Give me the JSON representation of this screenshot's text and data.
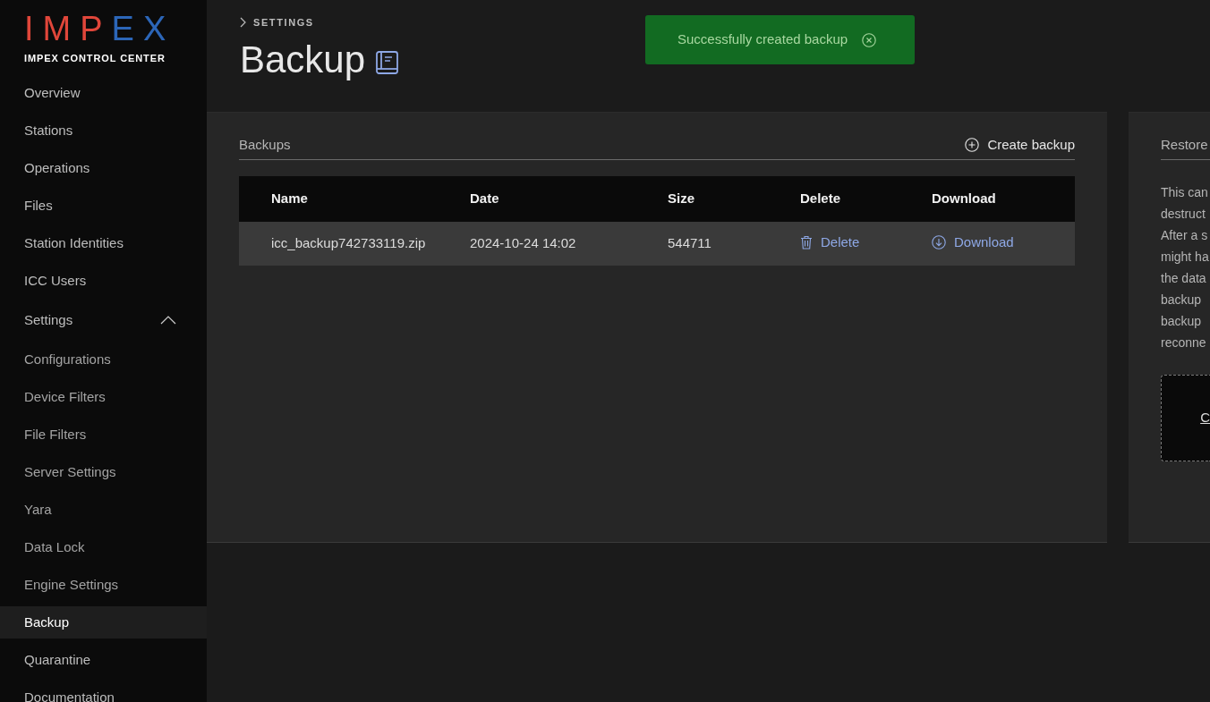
{
  "sidebar": {
    "logo": {
      "parts": [
        {
          "text": "IMP",
          "color": "#e0463a"
        },
        {
          "text": "EX",
          "color": "#2c66b8"
        }
      ],
      "subtitle": "IMPEX CONTROL CENTER"
    },
    "items": [
      {
        "label": "Overview",
        "selected": false
      },
      {
        "label": "Stations",
        "selected": false
      },
      {
        "label": "Operations",
        "selected": false
      },
      {
        "label": "Files",
        "selected": false
      },
      {
        "label": "Station Identities",
        "selected": false
      },
      {
        "label": "ICC Users",
        "selected": false
      },
      {
        "label": "Settings",
        "selected": false,
        "expanded": true,
        "children": [
          {
            "label": "Configurations",
            "selected": false
          },
          {
            "label": "Device Filters",
            "selected": false
          },
          {
            "label": "File Filters",
            "selected": false
          },
          {
            "label": "Server Settings",
            "selected": false
          },
          {
            "label": "Yara",
            "selected": false
          },
          {
            "label": "Data Lock",
            "selected": false
          },
          {
            "label": "Engine Settings",
            "selected": false
          },
          {
            "label": "Backup",
            "selected": true
          }
        ]
      },
      {
        "label": "Quarantine",
        "selected": false
      },
      {
        "label": "Documentation",
        "selected": false
      }
    ]
  },
  "breadcrumb": [
    "SETTINGS"
  ],
  "page_title": "Backup",
  "toast": {
    "message": "Successfully created backup"
  },
  "backups_panel": {
    "title": "Backups",
    "create_button": "Create backup",
    "table": {
      "columns": [
        "Name",
        "Date",
        "Size",
        "Delete",
        "Download"
      ],
      "rows": [
        {
          "name": "icc_backup742733119.zip",
          "date": "2024-10-24 14:02",
          "size": "544711",
          "delete": "Delete",
          "download": "Download"
        }
      ]
    }
  },
  "restore_panel": {
    "title": "Restore",
    "description_lines": [
      "This can",
      "destruct",
      "After a s",
      "might ha",
      "the data",
      "backup",
      "backup",
      "reconne"
    ],
    "drop_zone": {
      "link": "C"
    }
  }
}
